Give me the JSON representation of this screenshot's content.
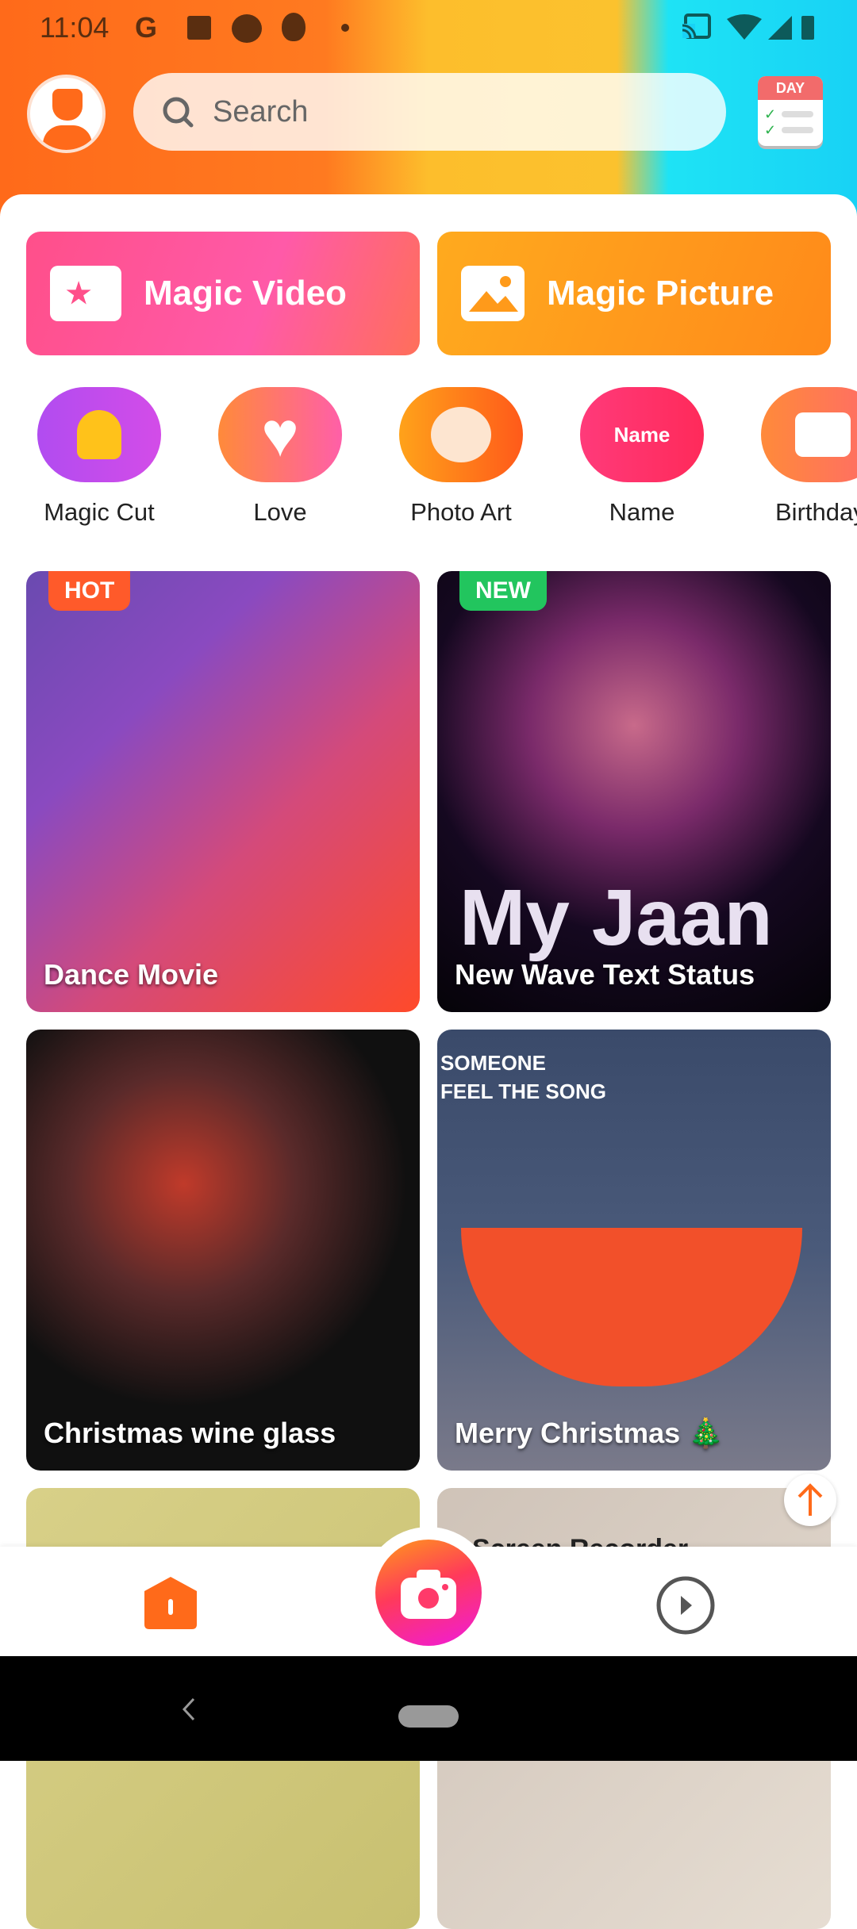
{
  "status_bar": {
    "time": "11:04",
    "left_icons": [
      "google-icon",
      "gallery-icon",
      "cat-icon",
      "fire-icon",
      "dot-icon"
    ],
    "right_icons": [
      "cast-icon",
      "wifi-icon",
      "signal-icon",
      "battery-charging-icon"
    ]
  },
  "header": {
    "search_placeholder": "Search",
    "calendar_label": "DAY"
  },
  "magic": {
    "video": "Magic Video",
    "picture": "Magic Picture"
  },
  "categories": [
    {
      "label": "Magic Cut",
      "icon_text": ""
    },
    {
      "label": "Love",
      "icon_text": ""
    },
    {
      "label": "Photo Art",
      "icon_text": ""
    },
    {
      "label": "Name",
      "icon_text": "Name"
    },
    {
      "label": "Birthday",
      "icon_text": ""
    }
  ],
  "cards": [
    {
      "title": "Dance Movie",
      "badge": "HOT"
    },
    {
      "title": "New Wave Text Status",
      "badge": "NEW",
      "overlay": "My Jaan"
    },
    {
      "title": "Christmas wine glass"
    },
    {
      "title": "Merry Christmas 🎄",
      "overlay": "SOMEONE\nFEEL THE SONG"
    },
    {
      "title": ""
    },
    {
      "title": "Screen Recorder"
    }
  ],
  "colors": {
    "accent": "#ff6a1a",
    "hot": "#ff5a2a",
    "new": "#22c55e"
  }
}
